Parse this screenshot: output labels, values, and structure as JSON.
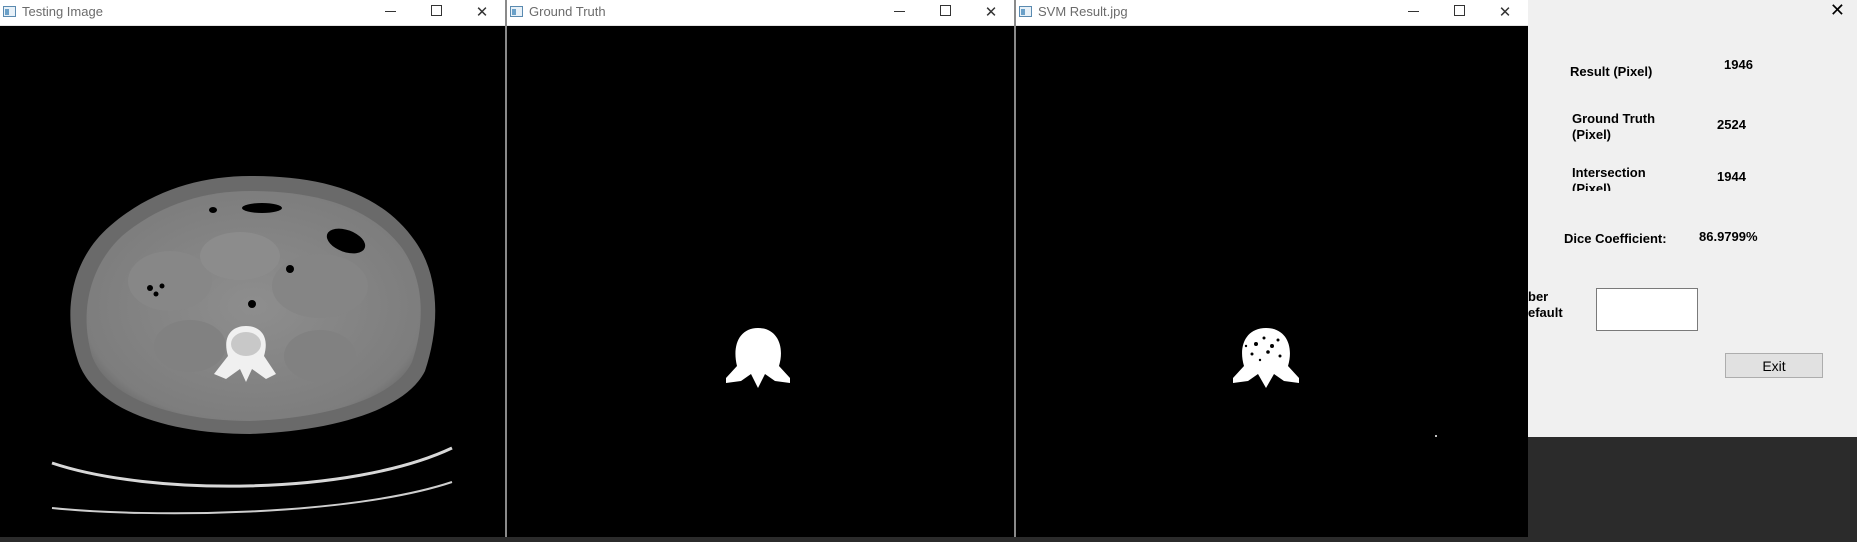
{
  "windows": [
    {
      "title": "Testing Image"
    },
    {
      "title": "Ground Truth"
    },
    {
      "title": "SVM Result.jpg"
    }
  ],
  "dialog": {
    "result_label": "Result (Pixel)",
    "result_value": "1946",
    "ground_truth_label": "Ground Truth (Pixel)",
    "ground_truth_value": "2524",
    "intersection_label": "Intersection (Pixel)",
    "intersection_value": "1944",
    "dice_label": "Dice Coefficient:",
    "dice_value": "86.9799%",
    "partial_label": "ber efault",
    "input_value": "",
    "exit_label": "Exit"
  },
  "icons": [
    "app-icon",
    "minimize-icon",
    "maximize-icon",
    "close-icon"
  ]
}
